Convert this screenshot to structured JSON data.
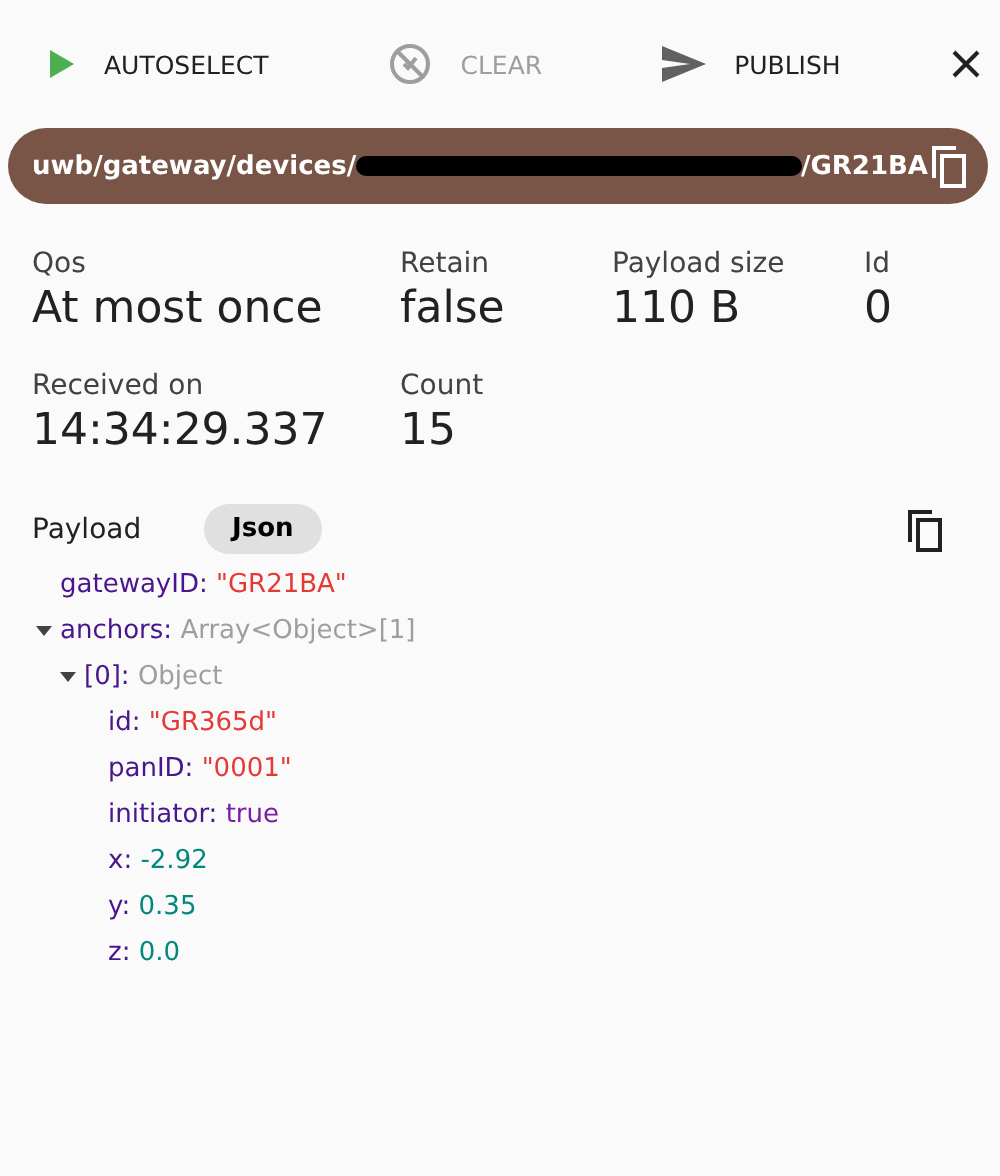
{
  "toolbar": [
    {
      "label": "AUTOSELECT",
      "disabled": false
    },
    {
      "label": "CLEAR",
      "disabled": true
    },
    {
      "label": "PUBLISH",
      "disabled": false
    }
  ],
  "topic": {
    "prefix": "uwb/gateway/devices/",
    "suffix": "/GR21BA",
    "redacted": true
  },
  "stats": [
    [
      {
        "label": "Qos",
        "value": "At most once"
      },
      {
        "label": "Retain",
        "value": "false"
      },
      {
        "label": "Payload size",
        "value": "110 B"
      },
      {
        "label": "Id",
        "value": "0"
      }
    ],
    [
      {
        "label": "Received on",
        "value": "14:34:29.337"
      },
      {
        "label": "Count",
        "value": "15"
      }
    ]
  ],
  "payload": {
    "label": "Payload",
    "format": "Json",
    "tree": [
      {
        "key": "gatewayID:",
        "value": "\"GR21BA\"",
        "kind": "string"
      },
      {
        "key": "anchors:",
        "value": "Array<Object>[1]",
        "kind": "type",
        "expanded": true,
        "children": [
          {
            "key": "[0]:",
            "value": "Object",
            "kind": "type",
            "expanded": true,
            "children": [
              {
                "key": "id:",
                "value": "\"GR365d\"",
                "kind": "string"
              },
              {
                "key": "panID:",
                "value": "\"0001\"",
                "kind": "string"
              },
              {
                "key": "initiator:",
                "value": "true",
                "kind": "boolean"
              },
              {
                "key": "x:",
                "value": "-2.92",
                "kind": "number"
              },
              {
                "key": "y:",
                "value": "0.35",
                "kind": "number"
              },
              {
                "key": "z:",
                "value": "0.0",
                "kind": "number"
              }
            ]
          }
        ]
      }
    ]
  }
}
